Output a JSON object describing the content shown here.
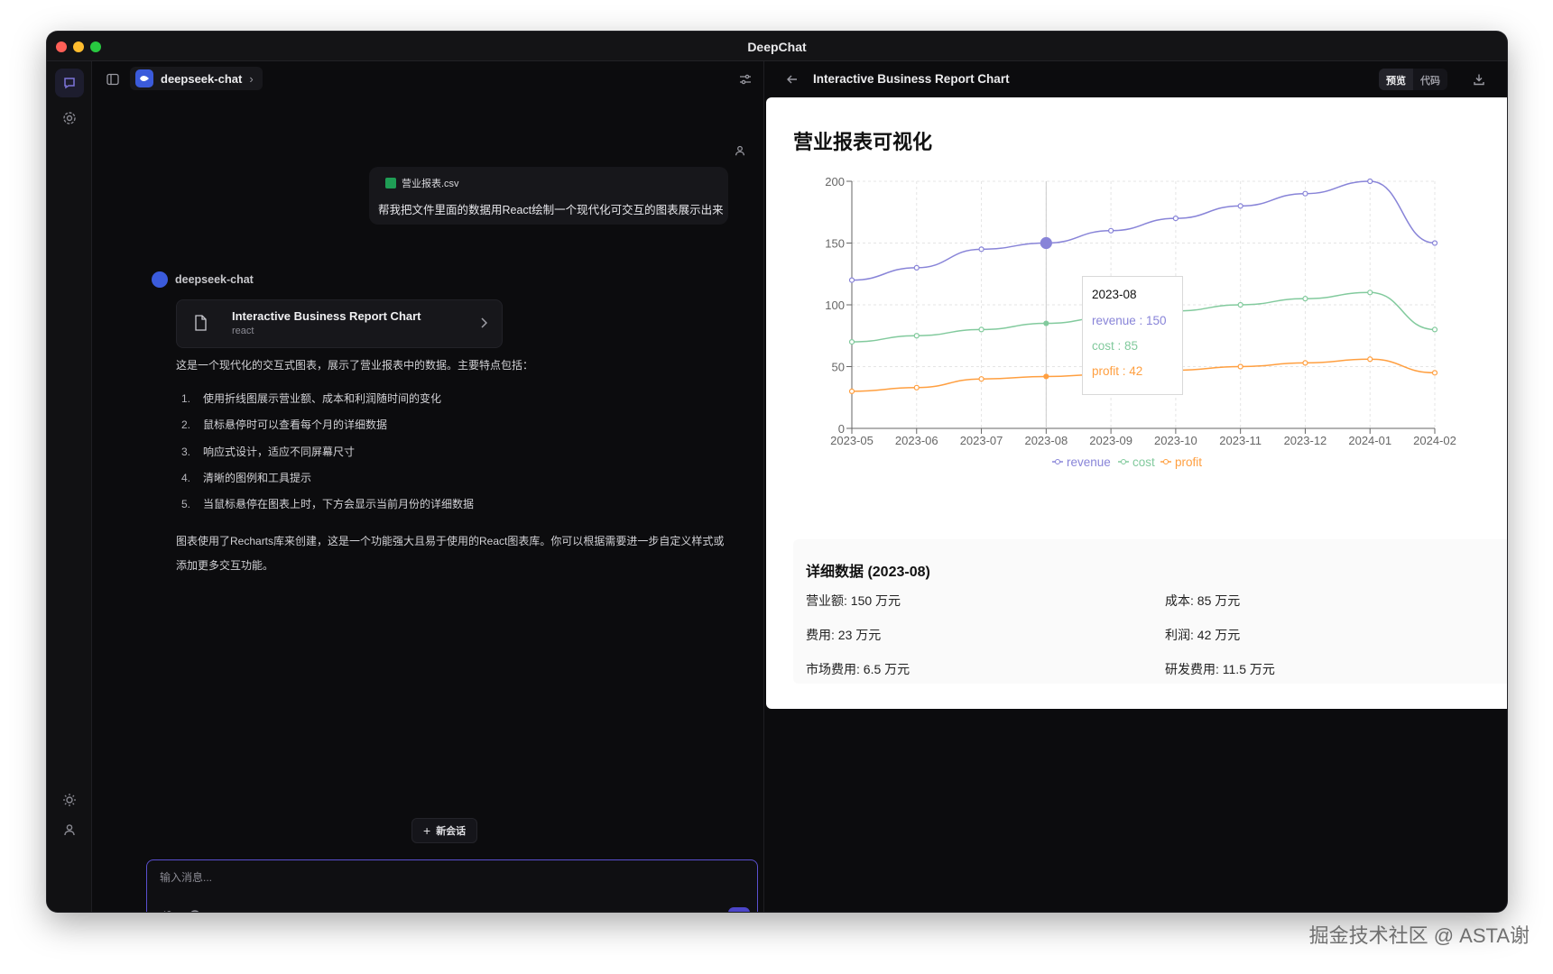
{
  "window": {
    "title": "DeepChat"
  },
  "sidebar": {
    "model_name": "deepseek-chat"
  },
  "conversation": {
    "user_message": {
      "attachment_name": "营业报表.csv",
      "text": "帮我把文件里面的数据用React绘制一个现代化可交互的图表展示出来"
    },
    "assistant": {
      "name": "deepseek-chat",
      "artifact": {
        "title": "Interactive Business Report Chart",
        "type": "react"
      },
      "intro": "这是一个现代化的交互式图表，展示了营业报表中的数据。主要特点包括：",
      "points": [
        {
          "n": "1.",
          "text": "使用折线图展示营业额、成本和利润随时间的变化"
        },
        {
          "n": "2.",
          "text": "鼠标悬停时可以查看每个月的详细数据"
        },
        {
          "n": "3.",
          "text": "响应式设计，适应不同屏幕尺寸"
        },
        {
          "n": "4.",
          "text": "清晰的图例和工具提示"
        },
        {
          "n": "5.",
          "text": "当鼠标悬停在图表上时，下方会显示当前月份的详细数据"
        }
      ],
      "outro": "图表使用了Recharts库来创建，这是一个功能强大且易于使用的React图表库。你可以根据需要进一步自定义样式或添加更多交互功能。"
    }
  },
  "new_chat_label": "新会话",
  "composer": {
    "placeholder": "输入消息..."
  },
  "artifact_panel": {
    "title": "Interactive Business Report Chart",
    "tab_preview": "预览",
    "tab_code": "代码"
  },
  "report": {
    "title": "营业报表可视化",
    "tooltip": {
      "date": "2023-08",
      "revenue": "revenue : 150",
      "cost": "cost : 85",
      "profit": "profit : 42"
    },
    "details_title": "详细数据 (2023-08)",
    "details": [
      "营业额: 150 万元",
      "成本: 85 万元",
      "费用: 23 万元",
      "利润: 42 万元",
      "市场费用: 6.5 万元",
      "研发费用: 11.5 万元"
    ]
  },
  "chart_data": {
    "type": "line",
    "categories": [
      "2023-05",
      "2023-06",
      "2023-07",
      "2023-08",
      "2023-09",
      "2023-10",
      "2023-11",
      "2023-12",
      "2024-01",
      "2024-02"
    ],
    "series": [
      {
        "name": "revenue",
        "color": "#8884d8",
        "values": [
          120,
          130,
          145,
          150,
          160,
          170,
          180,
          190,
          200,
          150
        ]
      },
      {
        "name": "cost",
        "color": "#82ca9d",
        "values": [
          70,
          75,
          80,
          85,
          90,
          95,
          100,
          105,
          110,
          80
        ]
      },
      {
        "name": "profit",
        "color": "#ff9f40",
        "values": [
          30,
          33,
          40,
          42,
          44,
          47,
          50,
          53,
          56,
          45
        ]
      }
    ],
    "ylim": [
      0,
      200
    ],
    "yticks": [
      "0",
      "50",
      "100",
      "150",
      "200"
    ],
    "grid": true,
    "legend": "bottom",
    "active_category": "2023-08"
  },
  "watermark": "掘金技术社区 @ ASTA谢"
}
